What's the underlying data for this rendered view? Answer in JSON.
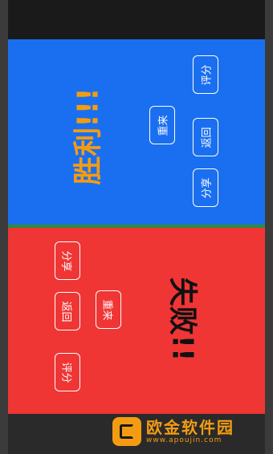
{
  "win_panel": {
    "title": "胜利!!!",
    "buttons": {
      "rate": "评分",
      "back": "返回",
      "share": "分享",
      "restart": "重来"
    }
  },
  "lose_panel": {
    "title": "失败!!",
    "buttons": {
      "share": "分享",
      "back": "返回",
      "rate": "评分",
      "restart": "重来"
    }
  },
  "watermark": {
    "name": "欧金软件园",
    "url": "www.apoujin.com"
  },
  "colors": {
    "win_bg": "#1a6ff0",
    "lose_bg": "#f03535",
    "win_text": "#f39c12",
    "lose_text": "#111111",
    "divider": "#2e8b3e"
  }
}
